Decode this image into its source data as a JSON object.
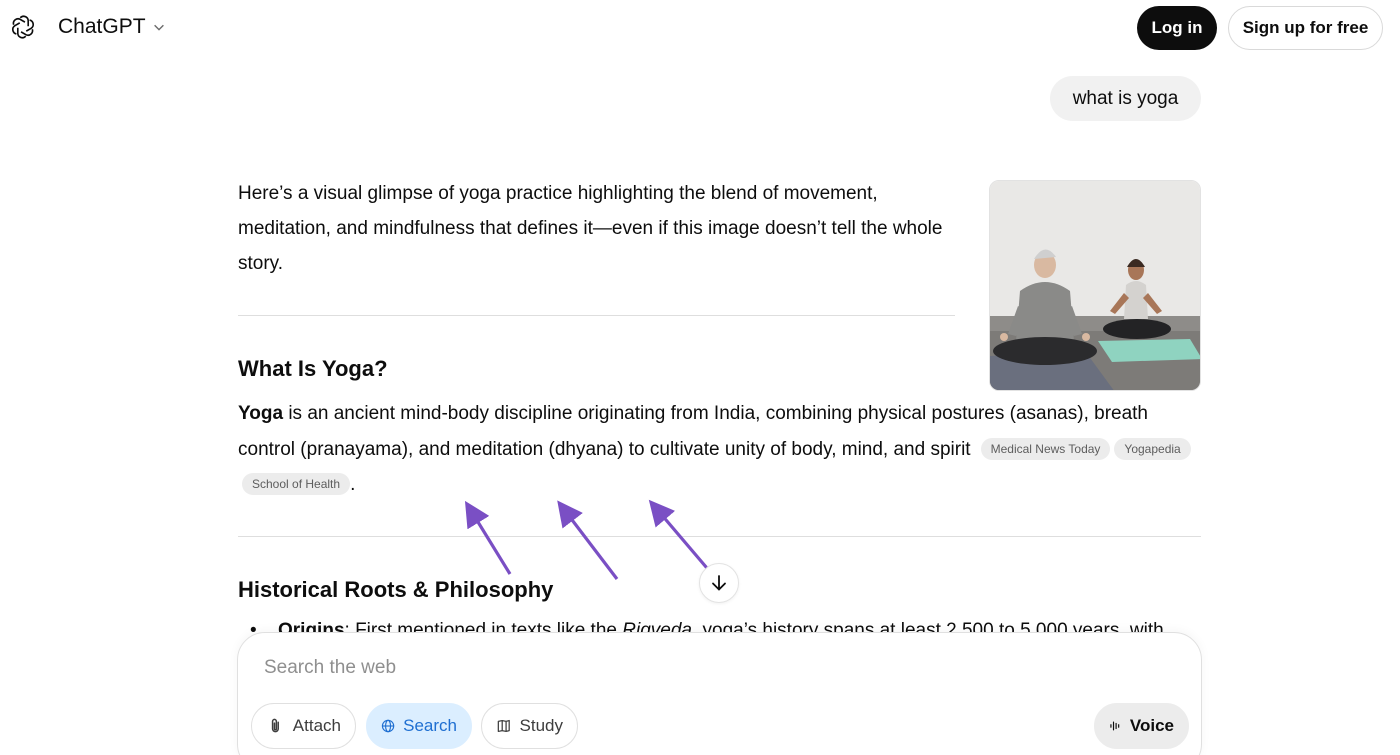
{
  "header": {
    "app_name": "ChatGPT",
    "login_label": "Log in",
    "signup_label": "Sign up for free"
  },
  "conversation": {
    "user_message": "what is yoga",
    "intro_text": "Here’s a visual glimpse of yoga practice highlighting the blend of movement, meditation, and mindfulness that defines it—even if this image doesn’t tell the whole story.",
    "section1_heading": "What Is Yoga?",
    "section1_bold": "Yoga",
    "section1_text": " is an ancient mind-body discipline originating from India, combining physical postures (asanas), breath control (pranayama), and meditation (dhyana) to cultivate unity of body, mind, and spirit",
    "citations": [
      "Medical News Today",
      "Yogapedia",
      "School of Health"
    ],
    "section1_end": ".",
    "section2_heading": "Historical Roots & Philosophy",
    "list_item_bold": "Origins",
    "list_item_text_a": ": First mentioned in texts like the ",
    "list_item_italic": "Rigveda",
    "list_item_text_b": ", yoga’s history spans at least 2,500 to 5,000 years, with"
  },
  "composer": {
    "placeholder": "Search the web",
    "attach_label": "Attach",
    "search_label": "Search",
    "study_label": "Study",
    "voice_label": "Voice"
  },
  "colors": {
    "annotation_arrow": "#7a4fc4",
    "search_active_bg": "#dbeeff",
    "search_active_fg": "#1f6fd1"
  }
}
